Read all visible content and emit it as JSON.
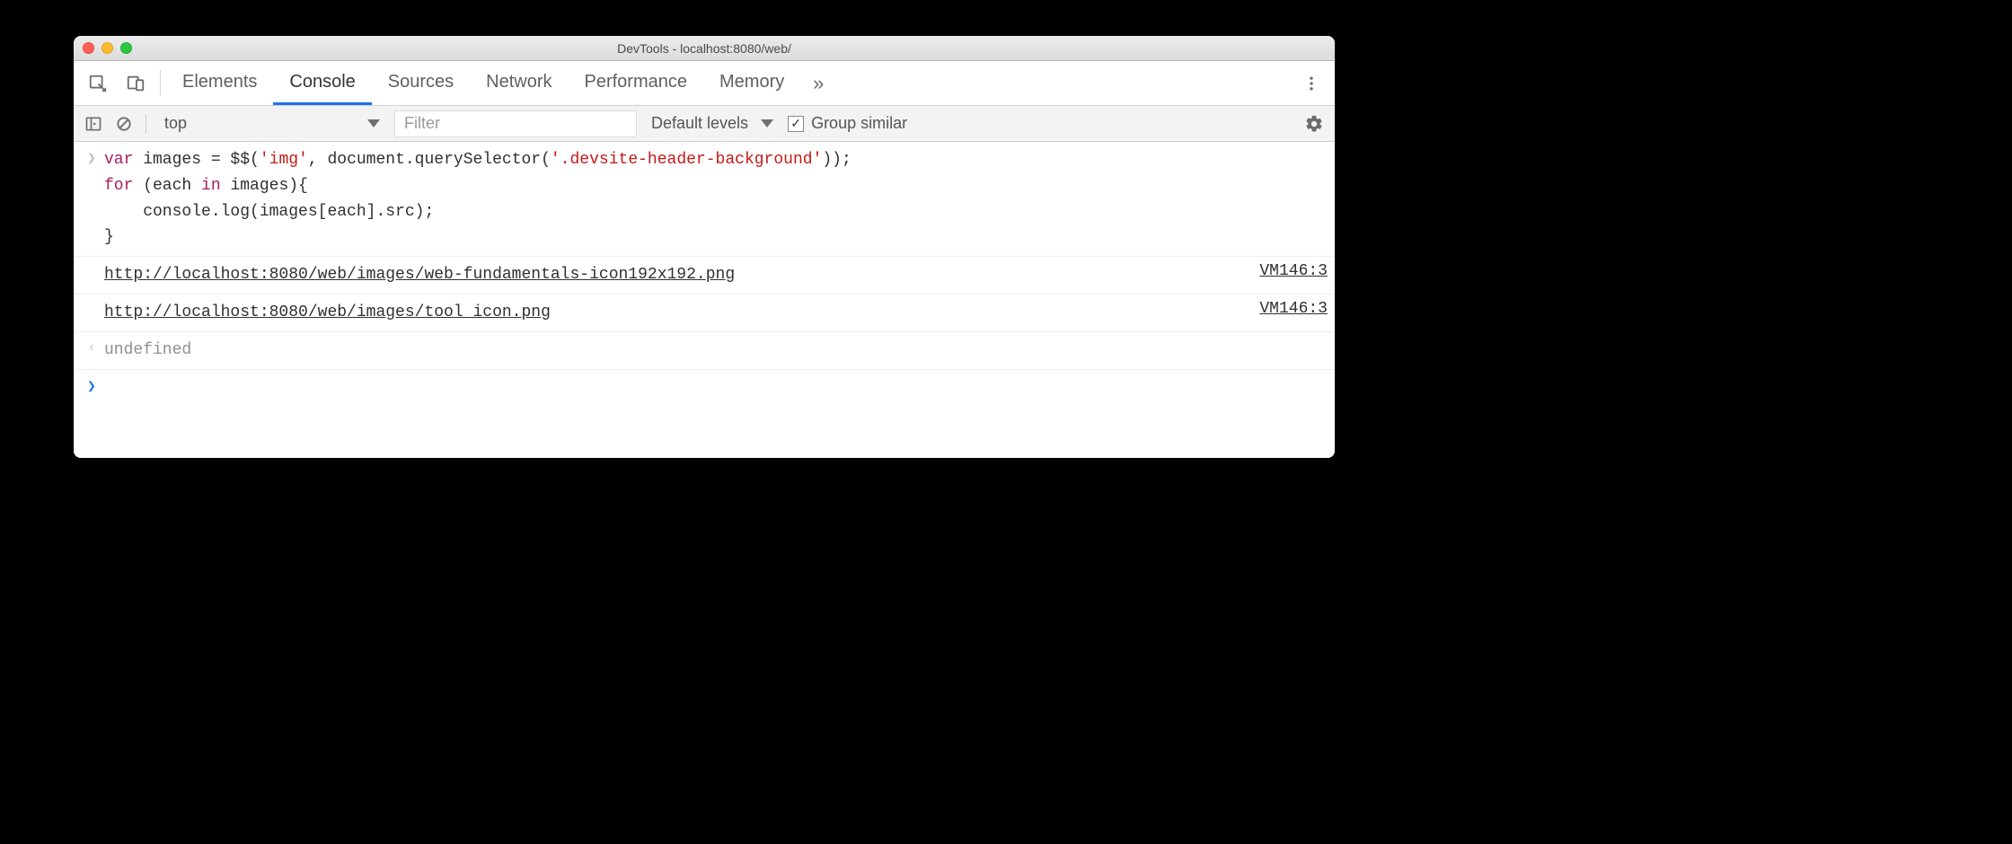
{
  "window": {
    "title": "DevTools - localhost:8080/web/"
  },
  "tabs": {
    "items": [
      "Elements",
      "Console",
      "Sources",
      "Network",
      "Performance",
      "Memory"
    ],
    "active_index": 1,
    "overflow_glyph": "»"
  },
  "console_toolbar": {
    "context": "top",
    "filter_placeholder": "Filter",
    "levels_label": "Default levels",
    "group_similar_label": "Group similar",
    "group_similar_checked": true
  },
  "console": {
    "input_code_html": "<span class=\"kw\">var</span> images = $$(<span class=\"str\">'img'</span>, document.querySelector(<span class=\"str\">'.devsite-header-background'</span>));\n<span class=\"kw\">for</span> (each <span class=\"kw\">in</span> images){\n    console.log(images[each].src);\n}",
    "logs": [
      {
        "text": "http://localhost:8080/web/images/web-fundamentals-icon192x192.png",
        "source": "VM146:3"
      },
      {
        "text": "http://localhost:8080/web/images/tool_icon.png",
        "source": "VM146:3"
      }
    ],
    "result_text": "undefined"
  }
}
